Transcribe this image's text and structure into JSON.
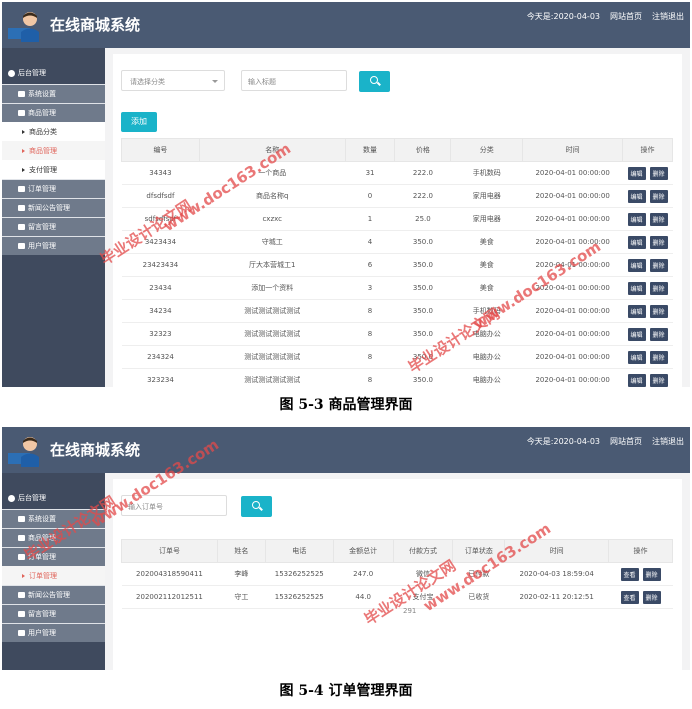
{
  "system_title": "在线商城系统",
  "header_links": [
    "今天是:2020-04-03",
    "网站首页",
    "注销退出"
  ],
  "sidebar_root": "后台管理",
  "sidebar_menu1": [
    {
      "label": "系统设置",
      "type": "grp"
    },
    {
      "label": "商品管理",
      "type": "grp"
    },
    {
      "label": "商品分类",
      "type": "sub"
    },
    {
      "label": "商品管理",
      "type": "sub",
      "active": true
    },
    {
      "label": "支付管理",
      "type": "sub"
    },
    {
      "label": "订单管理",
      "type": "grp"
    },
    {
      "label": "新闻公告管理",
      "type": "grp"
    },
    {
      "label": "留言管理",
      "type": "grp"
    },
    {
      "label": "用户管理",
      "type": "grp"
    }
  ],
  "sidebar_menu2": [
    {
      "label": "系统设置",
      "type": "grp"
    },
    {
      "label": "商品管理",
      "type": "grp"
    },
    {
      "label": "订单管理",
      "type": "grp"
    },
    {
      "label": "订单管理",
      "type": "sub",
      "active": true
    },
    {
      "label": "新闻公告管理",
      "type": "grp"
    },
    {
      "label": "留言管理",
      "type": "grp"
    },
    {
      "label": "用户管理",
      "type": "grp"
    }
  ],
  "screen1": {
    "select_placeholder": "请选择分类",
    "title_placeholder": "输入标题",
    "add_label": "添加",
    "columns": [
      "编号",
      "名称",
      "数量",
      "价格",
      "分类",
      "时间",
      "操作"
    ],
    "rows": [
      [
        "34343",
        "一个商品",
        "31",
        "222.0",
        "手机数码",
        "2020-04-01 00:00:00"
      ],
      [
        "dfsdfsdf",
        "商品名称q",
        "0",
        "222.0",
        "家用电器",
        "2020-04-01 00:00:00"
      ],
      [
        "sdfsdfsdf",
        "cxzxc",
        "1",
        "25.0",
        "家用电器",
        "2020-04-01 00:00:00"
      ],
      [
        "3423434",
        "守城工",
        "4",
        "350.0",
        "美食",
        "2020-04-01 00:00:00"
      ],
      [
        "23423434",
        "厅大本营城工1",
        "6",
        "350.0",
        "美食",
        "2020-04-01 00:00:00"
      ],
      [
        "23434",
        "添加一个资料",
        "3",
        "350.0",
        "美食",
        "2020-04-01 00:00:00"
      ],
      [
        "34234",
        "测试测试测试测试",
        "8",
        "350.0",
        "手机数码",
        "2020-04-01 00:00:00"
      ],
      [
        "32323",
        "测试测试测试测试",
        "8",
        "350.0",
        "电脑办公",
        "2020-04-01 00:00:00"
      ],
      [
        "234324",
        "测试测试测试测试",
        "8",
        "350.0",
        "电脑办公",
        "2020-04-01 00:00:00"
      ],
      [
        "323234",
        "测试测试测试测试",
        "8",
        "350.0",
        "电脑办公",
        "2020-04-01 00:00:00"
      ]
    ],
    "ops": [
      "编辑",
      "删除"
    ]
  },
  "screen2": {
    "order_placeholder": "输入订单号",
    "columns": [
      "订单号",
      "姓名",
      "电话",
      "金额总计",
      "付款方式",
      "订单状态",
      "时间",
      "操作"
    ],
    "rows": [
      [
        "202004318590411",
        "李峰",
        "15326252525",
        "247.0",
        "微信",
        "已付款",
        "2020-04-03 18:59:04"
      ],
      [
        "202002112012511",
        "守工",
        "15326252525",
        "44.0",
        "支付宝",
        "已收货",
        "2020-02-11 20:12:51"
      ]
    ],
    "ops": [
      "查看",
      "删除"
    ],
    "footer_num": "291"
  },
  "captions": [
    "图 5-3  商品管理界面",
    "图 5-4  订单管理界面"
  ],
  "watermarks": [
    "毕业设计论文网",
    "www.doc163.com"
  ]
}
